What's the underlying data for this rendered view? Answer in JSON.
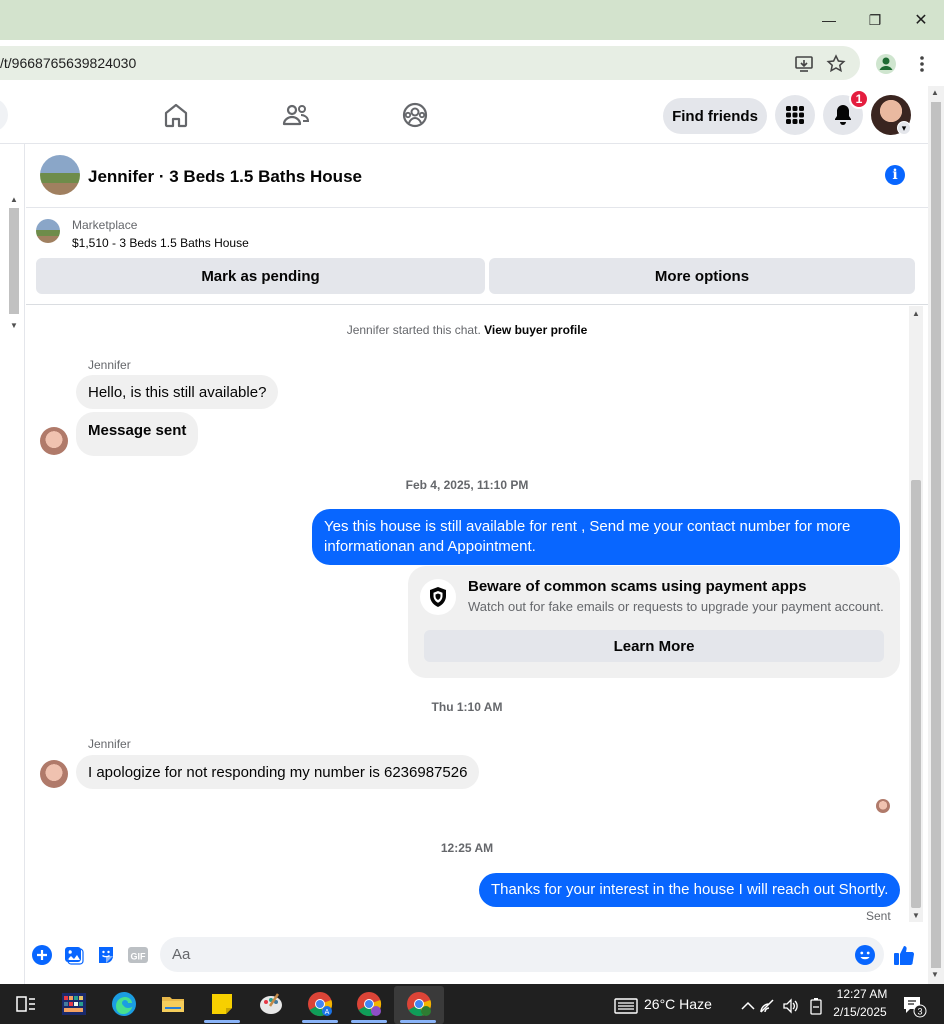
{
  "browser": {
    "url": "/t/9668765639824030",
    "window_controls": {
      "minimize": "—",
      "restore": "❐",
      "close": "✕"
    }
  },
  "fb_header": {
    "find_friends_label": "Find friends",
    "notification_count": "1"
  },
  "chat": {
    "title": "Jennifer · 3 Beds 1.5 Baths House",
    "marketplace_label": "Marketplace",
    "listing": "$1,510 - 3 Beds 1.5 Baths House",
    "mark_pending_label": "Mark as pending",
    "more_options_label": "More options",
    "system_note_prefix": "Jennifer started this chat.",
    "system_note_link": "View buyer profile",
    "messages": [
      {
        "sender": "Jennifer",
        "text": "Hello, is this still available?"
      },
      {
        "text": "Message sent"
      },
      {
        "timestamp": "Feb 4, 2025, 11:10 PM"
      },
      {
        "text": "Yes this house is still available for rent , Send me your contact number for more informationan and Appointment."
      },
      {
        "timestamp": "Thu 1:10 AM"
      },
      {
        "sender": "Jennifer",
        "text": "I apologize for not responding my number is 6236987526"
      },
      {
        "timestamp": "12:25 AM"
      },
      {
        "text": "Thanks for your interest in the house I will reach out Shortly."
      }
    ],
    "scam_card": {
      "title": "Beware of common scams using payment apps",
      "subtitle": "Watch out for fake emails or requests to upgrade your payment account.",
      "button": "Learn More"
    },
    "sent_status": "Sent",
    "composer_placeholder": "Aa"
  },
  "taskbar": {
    "weather": "26°C  Haze",
    "time": "12:27 AM",
    "date": "2/15/2025",
    "notification_count": "3"
  },
  "colors": {
    "messenger_blue": "#0866ff",
    "bubble_gray": "#f0f0f0",
    "badge_red": "#e41e3f"
  }
}
